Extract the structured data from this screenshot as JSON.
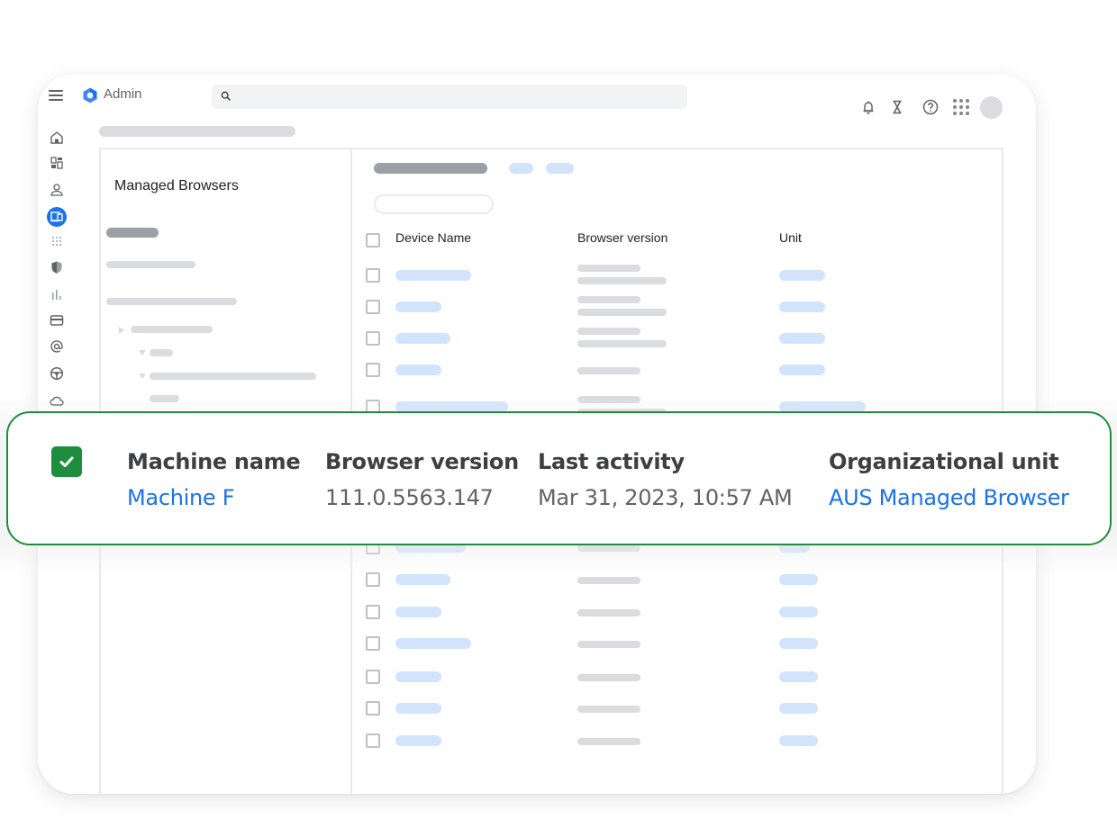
{
  "app": {
    "title": "Admin",
    "search": {
      "placeholder": "",
      "value": ""
    }
  },
  "header_icons": [
    "notifications-icon",
    "tasks-hourglass-icon",
    "help-icon",
    "apps-grid-icon",
    "account-avatar"
  ],
  "left_rail": {
    "items": [
      {
        "icon": "home-icon",
        "active": false
      },
      {
        "icon": "dashboard-icon",
        "active": false
      },
      {
        "icon": "users-icon",
        "active": false
      },
      {
        "icon": "devices-icon",
        "active": true
      },
      {
        "icon": "apps-icon",
        "active": false
      },
      {
        "icon": "security-shield-icon",
        "active": false
      },
      {
        "icon": "reports-icon",
        "active": false
      },
      {
        "icon": "billing-icon",
        "active": false
      },
      {
        "icon": "account-at-icon",
        "active": false
      },
      {
        "icon": "rules-icon",
        "active": false
      },
      {
        "icon": "storage-cloud-icon",
        "active": false
      }
    ]
  },
  "org_panel": {
    "title": "Managed Browsers"
  },
  "table": {
    "headers": {
      "device_name": "Device Name",
      "browser_version": "Browser version",
      "unit": "Unit"
    },
    "row_count_visible": 15
  },
  "highlight_card": {
    "selected": true,
    "accent_color": "#1e8e3e",
    "link_color": "#1a73e8",
    "columns": [
      {
        "header": "Machine name",
        "value": "Machine F",
        "is_link": true
      },
      {
        "header": "Browser version",
        "value": "111.0.5563.147",
        "is_link": false
      },
      {
        "header": "Last activity",
        "value": "Mar 31, 2023, 10:57 AM",
        "is_link": false
      },
      {
        "header": "Organizational unit",
        "value": "AUS Managed Browser",
        "is_link": true
      }
    ]
  },
  "colors": {
    "primary_blue": "#1a73e8",
    "skeleton_grey": "#dadce0",
    "skeleton_blue": "#d2e3fc",
    "success_green": "#1e8e3e"
  }
}
